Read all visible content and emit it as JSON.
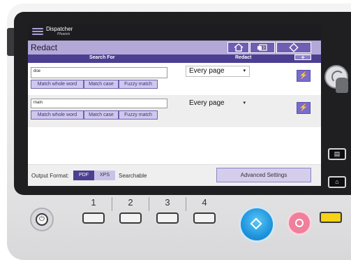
{
  "brand": {
    "name": "Dispatcher",
    "sub": "Phoenix"
  },
  "header": {
    "title": "Redact",
    "icons": [
      "home-icon",
      "job-log-icon",
      "start-icon"
    ]
  },
  "columns": {
    "search_for": "Search For",
    "redact": "Redact",
    "add_label": "+"
  },
  "rows": [
    {
      "term": "doe",
      "options": [
        "Match whole word",
        "Match case",
        "Fuzzy match"
      ],
      "redact_scope": "Every page",
      "dropdown_arrow": "▾"
    },
    {
      "term": "main",
      "options": [
        "Match whole word",
        "Match case",
        "Fuzzy match"
      ],
      "redact_scope": "Every page",
      "dropdown_arrow": "▾"
    }
  ],
  "footer": {
    "output_format_label": "Output Format:",
    "formats": [
      "PDF",
      "XPS"
    ],
    "selected_format": "PDF",
    "searchable_label": "Searchable",
    "advanced_button": "Advanced Settings"
  },
  "hardware": {
    "keys": [
      "1",
      "2",
      "3",
      "4"
    ]
  },
  "colors": {
    "accent": "#4c3f92",
    "title_bar": "#b4a8d8",
    "option_button": "#cfc8ec",
    "start_button": "#1f95dd",
    "stop_button": "#ef7f9a",
    "yellow_key": "#f5d315"
  }
}
